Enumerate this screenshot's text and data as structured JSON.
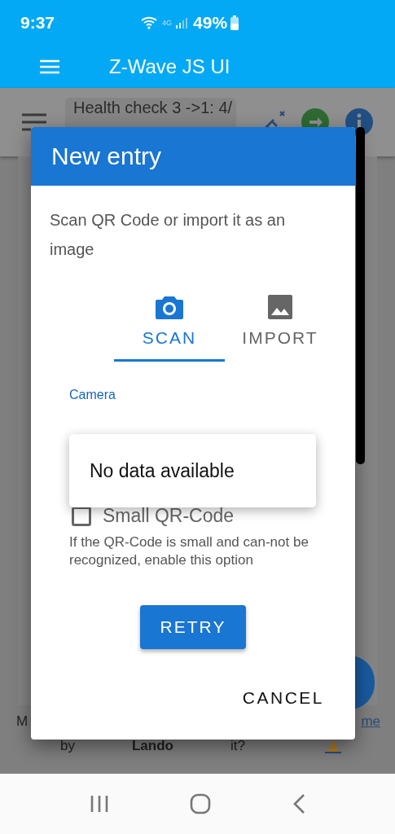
{
  "status_bar": {
    "time": "9:37",
    "network": "4G",
    "battery": "49%"
  },
  "app_bar": {
    "title": "Z-Wave JS UI"
  },
  "page": {
    "toolbar": {
      "search_value": "Health check 3 ->1: 4/"
    },
    "footer": {
      "line_1": [
        {
          "text": "M",
          "kind": "plain"
        },
        {
          "text": "me",
          "kind": "link"
        }
      ],
      "line_2": [
        {
          "text": "by",
          "kind": "plain"
        },
        {
          "text": "Lando",
          "kind": "bold"
        },
        {
          "text": "it?",
          "kind": "plain"
        }
      ]
    }
  },
  "dialog": {
    "title": "New entry",
    "description": "Scan QR Code or import it as an image",
    "tabs": [
      {
        "label": "SCAN",
        "kind": "camera",
        "selected": true
      },
      {
        "label": "IMPORT",
        "kind": "image",
        "selected": false
      }
    ],
    "camera_field": {
      "label": "Camera"
    },
    "menu": {
      "items": [
        "No data available"
      ]
    },
    "checkbox": {
      "label": "Small QR-Code",
      "checked": false,
      "hint": "If the QR-Code is small and can-not be recognized, enable this option"
    },
    "retry_button": "RETRY",
    "cancel_button": "CANCEL"
  }
}
